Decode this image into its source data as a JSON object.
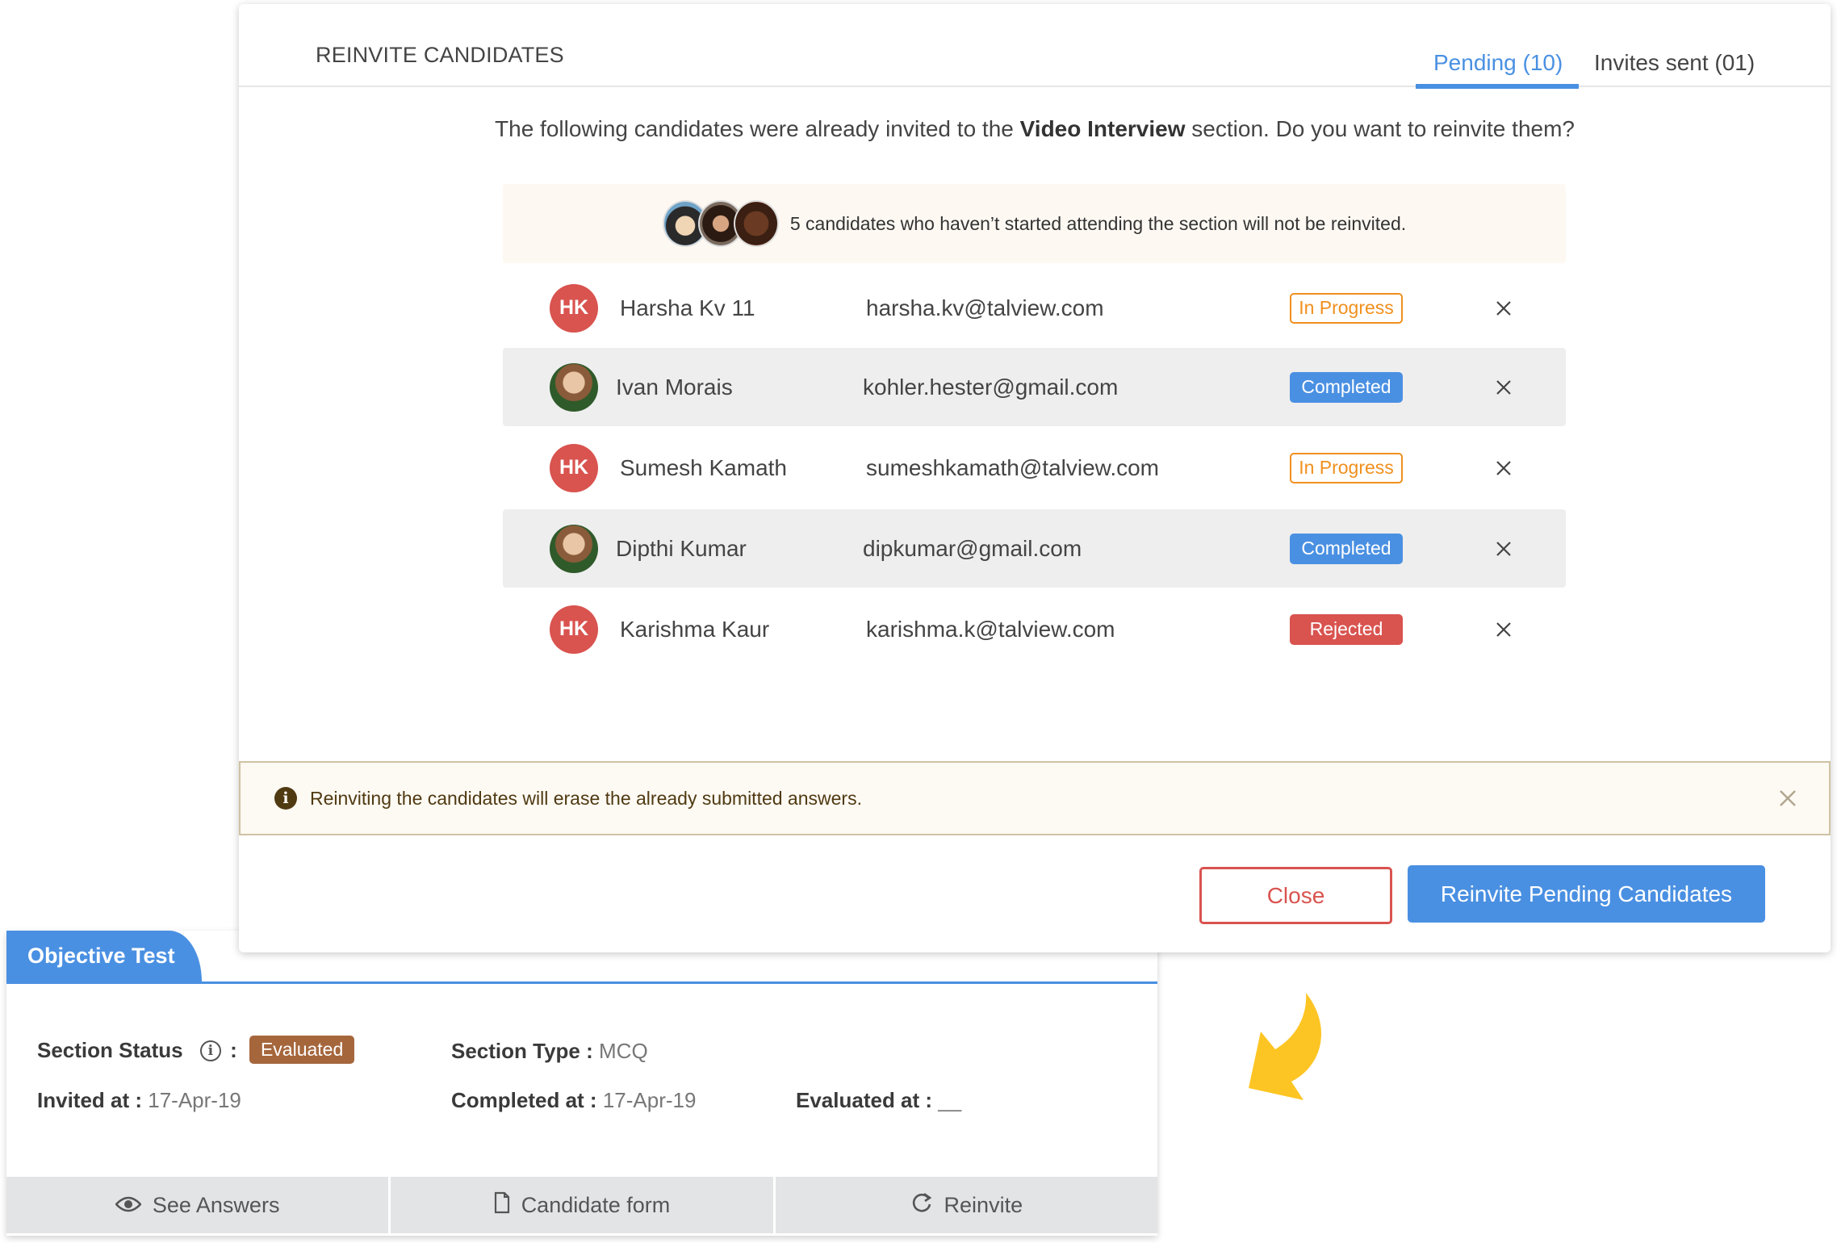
{
  "modal": {
    "title": "REINVITE CANDIDATES",
    "tabs": [
      {
        "label": "Pending (10)",
        "active": true
      },
      {
        "label": "Invites sent (01)",
        "active": false
      }
    ],
    "question": {
      "before": "The following candidates were already invited to the ",
      "section_name": "Video Interview",
      "after": " section. Do you want to reinvite them?"
    },
    "not_reinvited_banner": {
      "text": "5 candidates who haven’t started attending the section will not be reinvited.",
      "avatar_count": 3
    },
    "candidates": [
      {
        "avatar_type": "initials",
        "initials": "HK",
        "name": "Harsha Kv 11",
        "email": "harsha.kv@talview.com",
        "status": "In Progress",
        "status_kind": "inprogress"
      },
      {
        "avatar_type": "photo",
        "initials": "",
        "name": "Ivan Morais",
        "email": "kohler.hester@gmail.com",
        "status": "Completed",
        "status_kind": "completed"
      },
      {
        "avatar_type": "initials",
        "initials": "HK",
        "name": "Sumesh Kamath",
        "email": "sumeshkamath@talview.com",
        "status": "In Progress",
        "status_kind": "inprogress"
      },
      {
        "avatar_type": "photo",
        "initials": "",
        "name": "Dipthi Kumar",
        "email": "dipkumar@gmail.com",
        "status": "Completed",
        "status_kind": "completed"
      },
      {
        "avatar_type": "initials",
        "initials": "HK",
        "name": "Karishma Kaur",
        "email": "karishma.k@talview.com",
        "status": "Rejected",
        "status_kind": "rejected"
      }
    ],
    "warning": {
      "icon": "info-icon",
      "text": "Reinviting the candidates will erase the already submitted answers."
    },
    "buttons": {
      "close": "Close",
      "reinvite": "Reinvite Pending Candidates"
    }
  },
  "section_card": {
    "tab_label": "Objective Test",
    "status_label": "Section Status",
    "status_value": "Evaluated",
    "type_label": "Section Type :",
    "type_value": "MCQ",
    "invited_label": "Invited at :",
    "invited_value": "17-Apr-19",
    "completed_label": "Completed at :",
    "completed_value": "17-Apr-19",
    "evaluated_label": "Evaluated at :",
    "evaluated_value": "__",
    "actions": [
      {
        "icon": "eye-icon",
        "label": "See Answers"
      },
      {
        "icon": "document-icon",
        "label": "Candidate form"
      },
      {
        "icon": "refresh-icon",
        "label": "Reinvite"
      }
    ]
  },
  "colors": {
    "primary": "#4a90e2",
    "danger": "#d9534f",
    "warning": "#f0901e",
    "evaluated": "#a5663c",
    "arrow": "#fdc524"
  }
}
